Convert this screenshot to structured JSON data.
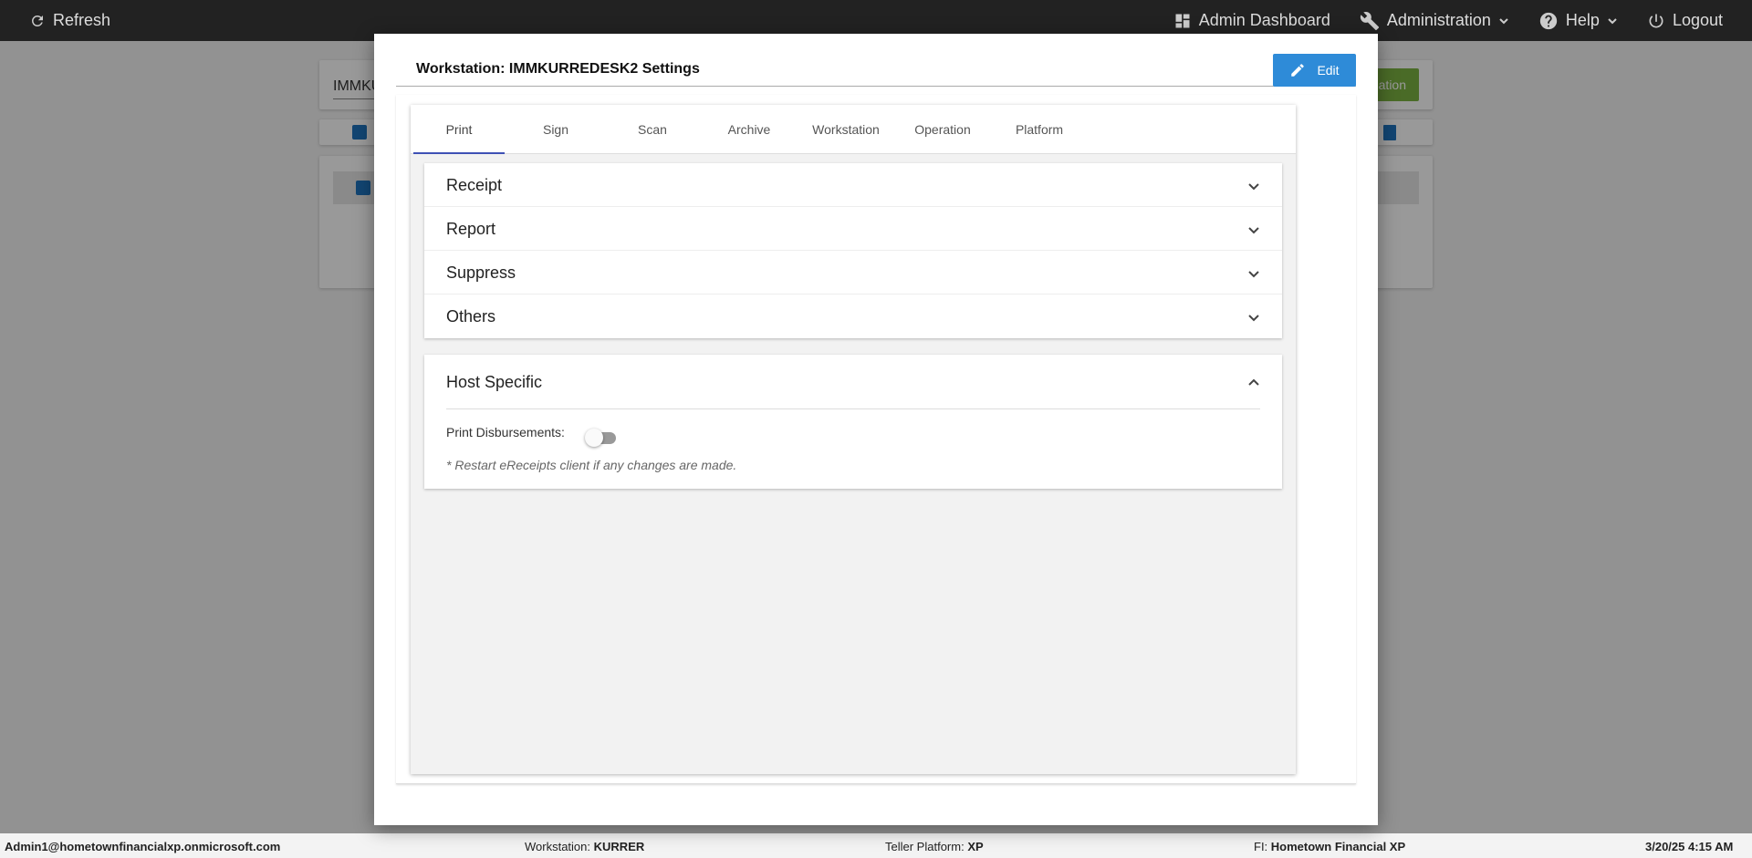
{
  "topbar": {
    "refresh_label": "Refresh",
    "admin_dashboard_label": "Admin Dashboard",
    "administration_label": "Administration",
    "help_label": "Help",
    "logout_label": "Logout"
  },
  "background": {
    "search_value": "IMMKU",
    "green_button_label": "ation"
  },
  "modal": {
    "title": "Workstation: IMMKURREDESK2 Settings",
    "edit_label": "Edit",
    "tabs": [
      {
        "label": "Print",
        "active": true
      },
      {
        "label": "Sign"
      },
      {
        "label": "Scan"
      },
      {
        "label": "Archive"
      },
      {
        "label": "Workstation"
      },
      {
        "label": "Operation"
      },
      {
        "label": "Platform"
      }
    ],
    "sections": [
      {
        "label": "Receipt"
      },
      {
        "label": "Report"
      },
      {
        "label": "Suppress"
      },
      {
        "label": "Others"
      }
    ],
    "host_specific": {
      "title": "Host Specific",
      "print_disbursements_label": "Print Disbursements:",
      "print_disbursements_on": false,
      "note": "* Restart eReceipts client if any changes are made."
    }
  },
  "statusbar": {
    "user": "Admin1@hometownfinancialxp.onmicrosoft.com",
    "workstation_label": "Workstation:",
    "workstation_value": "KURRER",
    "platform_label": "Teller Platform:",
    "platform_value": "XP",
    "fi_label": "FI:",
    "fi_value": "Hometown Financial XP",
    "datetime": "3/20/25 4:15 AM"
  },
  "colors": {
    "accent": "#2e8bd8",
    "tab_indicator": "#3f51b5",
    "topbar": "#222222"
  }
}
